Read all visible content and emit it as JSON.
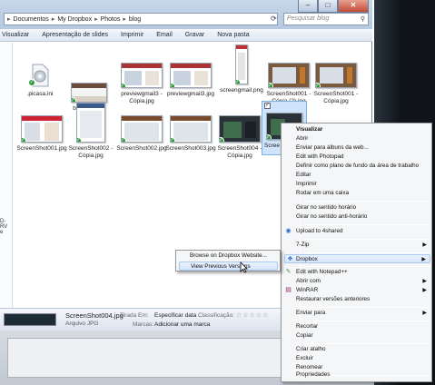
{
  "address": {
    "crumbs": [
      "Documentos",
      "My Dropbox",
      "Photos",
      "blog"
    ],
    "search_placeholder": "Pesquisar blog"
  },
  "toolbar": [
    "Visualizar",
    "Apresentação de slides",
    "Imprimir",
    "Email",
    "Gravar",
    "Nova pasta"
  ],
  "nav_fragments": [
    "D-RV",
    "e"
  ],
  "files": [
    {
      "name": ".picasa.ini"
    },
    {
      "name": "browser.png"
    },
    {
      "name": "previewgmail3 - Cópia.jpg"
    },
    {
      "name": "previewgmail3.jpg"
    },
    {
      "name": "screengmail.png"
    },
    {
      "name": "ScreenShot001 - Cópia (2).jpg"
    },
    {
      "name": "ScreenShot001 - Cópia.jpg"
    },
    {
      "name": "ScreenShot001.jpg"
    },
    {
      "name": "ScreenShot002 - Cópia.jpg"
    },
    {
      "name": "ScreenShot002.jpg"
    },
    {
      "name": "ScreenShot003.jpg"
    },
    {
      "name": "ScreenShot004 - Cópia.jpg"
    },
    {
      "name": "ScreenShot004.jpg",
      "label_visible": "Scree"
    }
  ],
  "details": {
    "filename": "ScreenShot004.jpg",
    "filetype": "Arquivo JPG",
    "taken_label": "Tirada Em:",
    "taken_value": "Especificar data",
    "tags_label": "Marcas:",
    "tags_value": "Adicionar uma marca",
    "rating_label": "Classificação:",
    "stars": "☆☆☆☆☆"
  },
  "context_menu": {
    "items": [
      {
        "label": "Visualizar",
        "bold": true
      },
      {
        "label": "Abrir"
      },
      {
        "label": "Enviar para álbuns da web..."
      },
      {
        "label": "Edit with Photopad"
      },
      {
        "label": "Definir como plano de fundo da área de trabalho"
      },
      {
        "label": "Editar"
      },
      {
        "label": "Imprimir"
      },
      {
        "label": "Rodar em uma caixa"
      },
      {
        "label": "Girar no sentido horário"
      },
      {
        "label": "Girar no sentido anti-horário"
      },
      {
        "label": "Upload to 4shared"
      },
      {
        "label": "7-Zip"
      },
      {
        "label": "Dropbox"
      },
      {
        "label": "Edit with Notepad++"
      },
      {
        "label": "Abrir com"
      },
      {
        "label": "WinRAR"
      },
      {
        "label": "Restaurar versões anteriores"
      },
      {
        "label": "Enviar para"
      },
      {
        "label": "Recortar"
      },
      {
        "label": "Copiar"
      },
      {
        "label": "Criar atalho"
      },
      {
        "label": "Excluir"
      },
      {
        "label": "Renomear"
      },
      {
        "label": "Propriedades"
      }
    ]
  },
  "submenu": {
    "items": [
      {
        "label": "Browse on Dropbox Website..."
      },
      {
        "label": "View Previous Versions"
      }
    ]
  },
  "colors": {
    "selection": "#d5e6fb",
    "check": "#2b9b3a",
    "titlebar": "#b6c9e0"
  }
}
